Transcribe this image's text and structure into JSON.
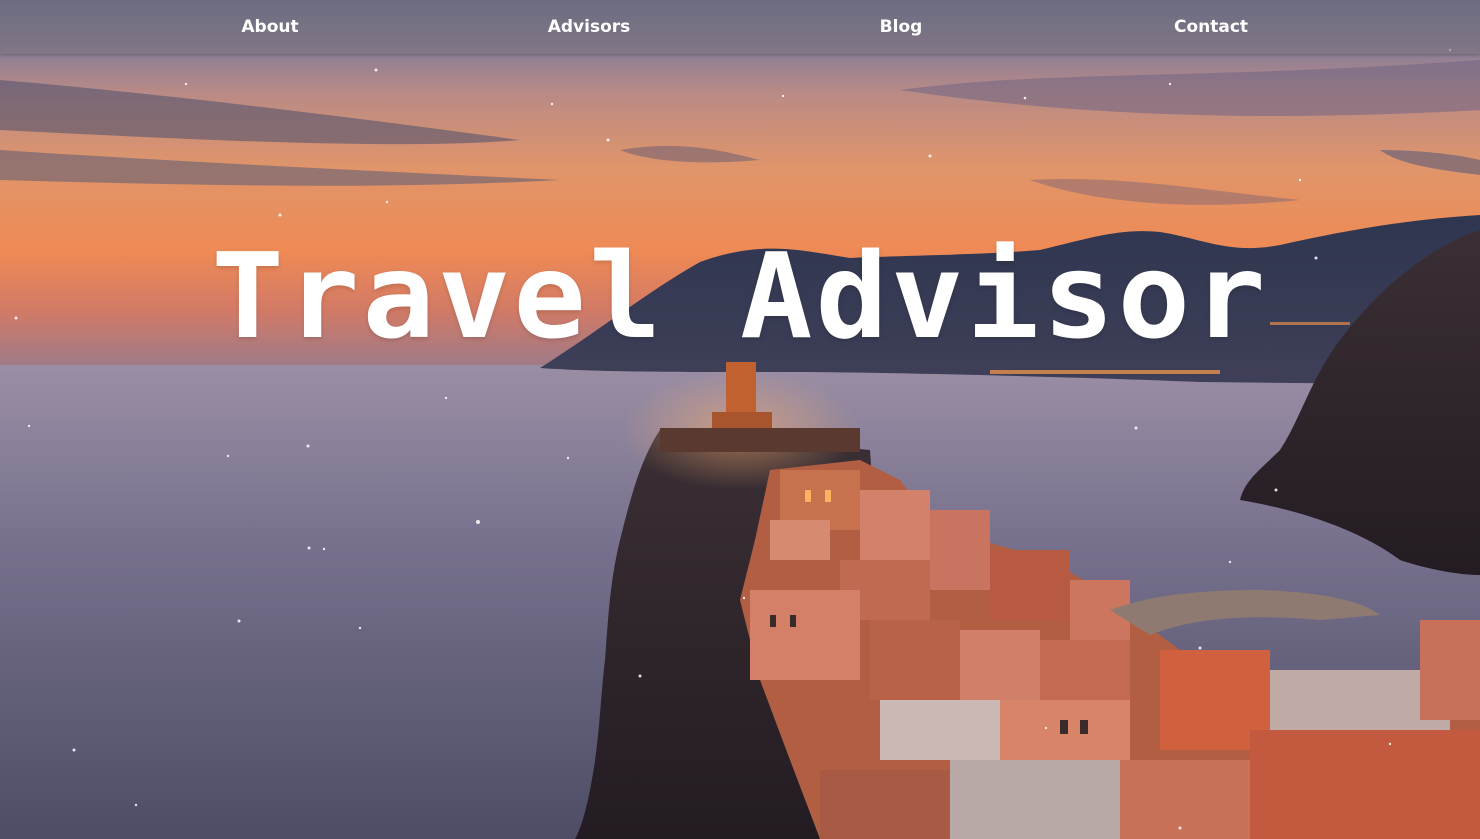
{
  "nav": {
    "items": [
      {
        "label": "About"
      },
      {
        "label": "Advisors"
      },
      {
        "label": "Blog"
      },
      {
        "label": "Contact"
      }
    ]
  },
  "hero": {
    "title": "Travel Advisor",
    "background": "sunset coastal cliff village photo"
  },
  "colors": {
    "nav_text": "#ffffff",
    "title_text": "#ffffff",
    "sky_orange": "#ef8a55",
    "sea": "#6b6a84",
    "rooftops": "#c86a4a"
  }
}
